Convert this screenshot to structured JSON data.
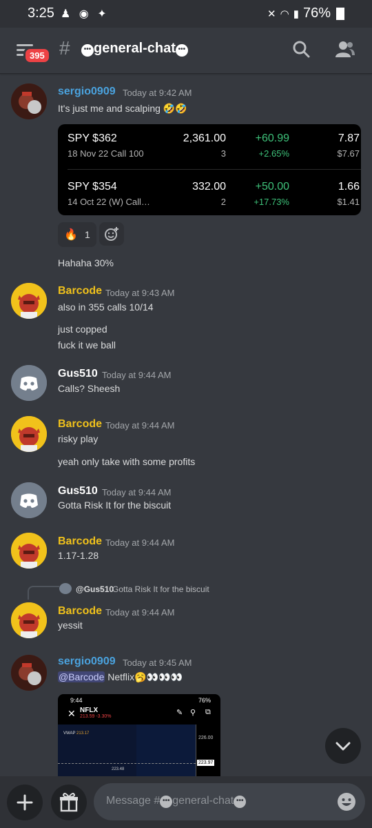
{
  "status": {
    "time": "3:25",
    "battery": "76%"
  },
  "header": {
    "badge": "395",
    "hash": "#",
    "channel_name": "general-chat",
    "channel_emoji": "•••"
  },
  "messages": [
    {
      "author": "sergio0909",
      "timestamp": "Today at 9:42 AM",
      "text": "It's just me and scalping",
      "emoji": "🤣🤣"
    },
    {
      "text": "Hahaha 30%"
    },
    {
      "author": "Barcode",
      "timestamp": "Today at 9:43 AM",
      "text": "also in 355 calls 10/14"
    },
    {
      "text": "just copped"
    },
    {
      "text": "fuck it we ball"
    },
    {
      "author": "Gus510",
      "timestamp": "Today at 9:44 AM",
      "text": "Calls? Sheesh"
    },
    {
      "author": "Barcode",
      "timestamp": "Today at 9:44 AM",
      "text": "risky play"
    },
    {
      "text": "yeah only take with some profits"
    },
    {
      "author": "Gus510",
      "timestamp": "Today at 9:44 AM",
      "text": "Gotta Risk It for the biscuit"
    },
    {
      "author": "Barcode",
      "timestamp": "Today at 9:44 AM",
      "text": "1.17-1.28"
    },
    {
      "reply_to": "@Gus510",
      "reply_text": "Gotta Risk It for the biscuit",
      "author": "Barcode",
      "timestamp": "Today at 9:44 AM",
      "text": "yessit"
    },
    {
      "author": "sergio0909",
      "timestamp": "Today at 9:45 AM",
      "mention": "@Barcode",
      "text": "Netflix",
      "emoji": "🥱👀👀👀"
    }
  ],
  "trade_card": {
    "rows": [
      {
        "ticker": "SPY $362",
        "contract": "18 Nov 22 Call 100",
        "value": "2,361.00",
        "qty": "3",
        "change": "+60.99",
        "change_pct": "+2.65%",
        "price": "7.87",
        "avg": "$7.67"
      },
      {
        "ticker": "SPY $354",
        "contract": "14 Oct 22 (W) Call…",
        "value": "332.00",
        "qty": "2",
        "change": "+50.00",
        "change_pct": "+17.73%",
        "price": "1.66",
        "avg": "$1.41"
      }
    ]
  },
  "reaction": {
    "emoji": "🔥",
    "count": "1"
  },
  "screenshot_embed": {
    "time": "9:44",
    "battery": "76%",
    "symbol": "NFLX",
    "quote": "213.59 -3.30%",
    "vwap_label": "VWAP",
    "vwap_value": "213.17",
    "price_top": "226.00",
    "price_mid": "223.97",
    "price_low": "223.48"
  },
  "composer": {
    "placeholder_prefix": "Message #",
    "placeholder_channel": "general-chat"
  },
  "colors": {
    "background": "#36393f",
    "sergio": "#4aa3df",
    "barcode": "#f1c21b",
    "gus": "#ffffff",
    "green": "#3ec27a",
    "badge": "#ed4245"
  }
}
